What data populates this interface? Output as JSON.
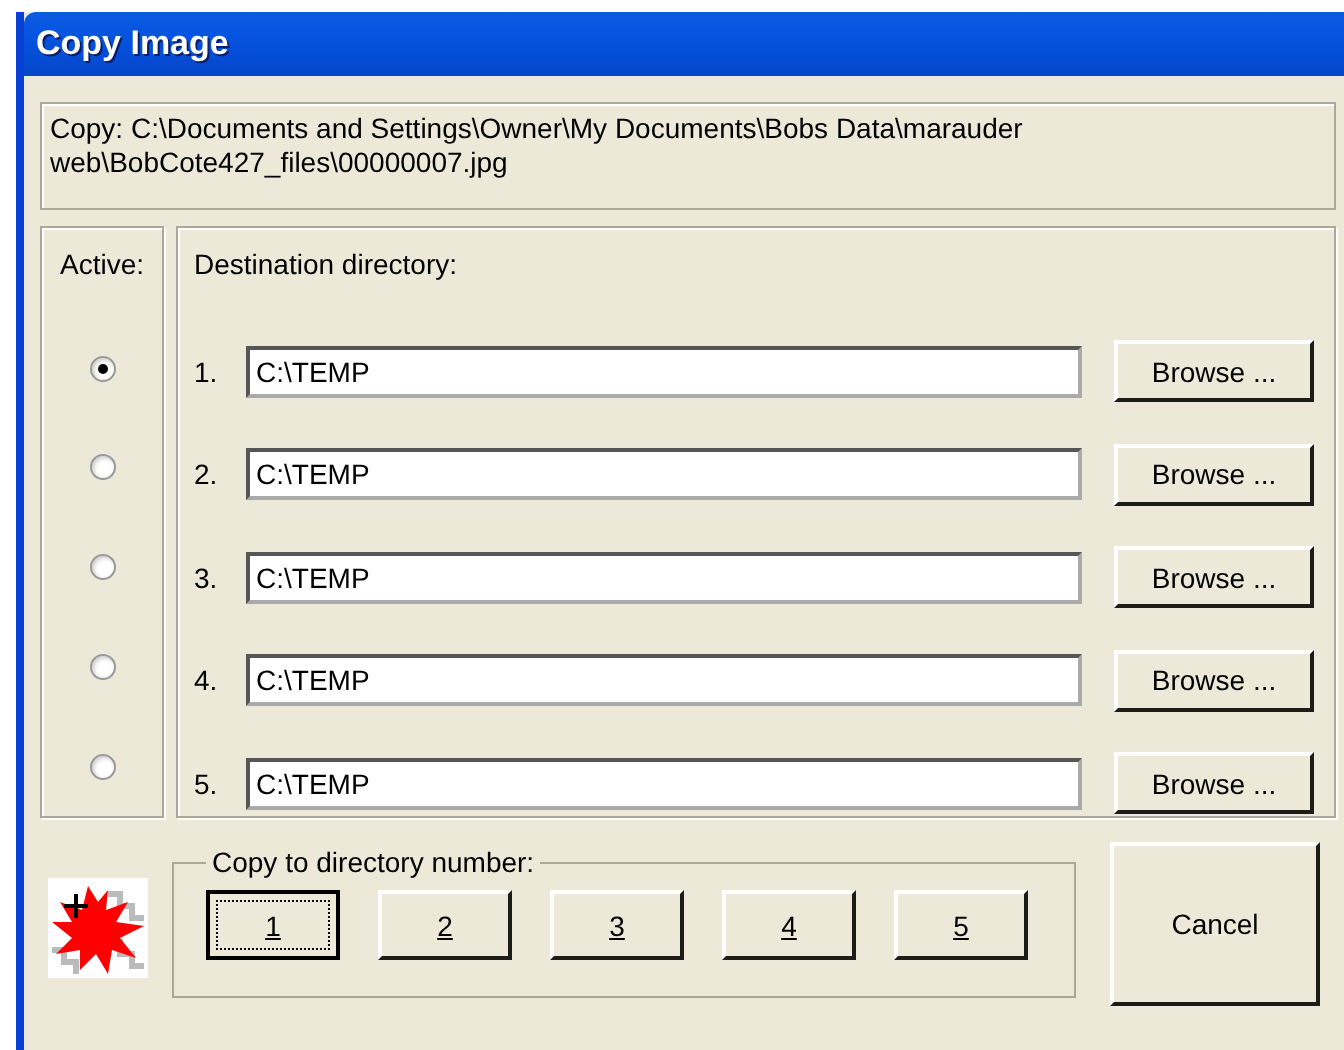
{
  "window": {
    "title": "Copy Image"
  },
  "source": {
    "text": "Copy: C:\\Documents and Settings\\Owner\\My Documents\\Bobs Data\\marauder web\\BobCote427_files\\00000007.jpg"
  },
  "active_label": "Active:",
  "destination_label": "Destination directory:",
  "directories": [
    {
      "number": "1.",
      "value": "C:\\TEMP",
      "selected": true,
      "browse": "Browse ..."
    },
    {
      "number": "2.",
      "value": "C:\\TEMP",
      "selected": false,
      "browse": "Browse ..."
    },
    {
      "number": "3.",
      "value": "C:\\TEMP",
      "selected": false,
      "browse": "Browse ..."
    },
    {
      "number": "4.",
      "value": "C:\\TEMP",
      "selected": false,
      "browse": "Browse ..."
    },
    {
      "number": "5.",
      "value": "C:\\TEMP",
      "selected": false,
      "browse": "Browse ..."
    }
  ],
  "copy_group": {
    "label": "Copy to directory number:",
    "buttons": [
      {
        "label": "1",
        "focused": true
      },
      {
        "label": "2",
        "focused": false
      },
      {
        "label": "3",
        "focused": false
      },
      {
        "label": "4",
        "focused": false
      },
      {
        "label": "5",
        "focused": false
      }
    ]
  },
  "cancel": "Cancel"
}
